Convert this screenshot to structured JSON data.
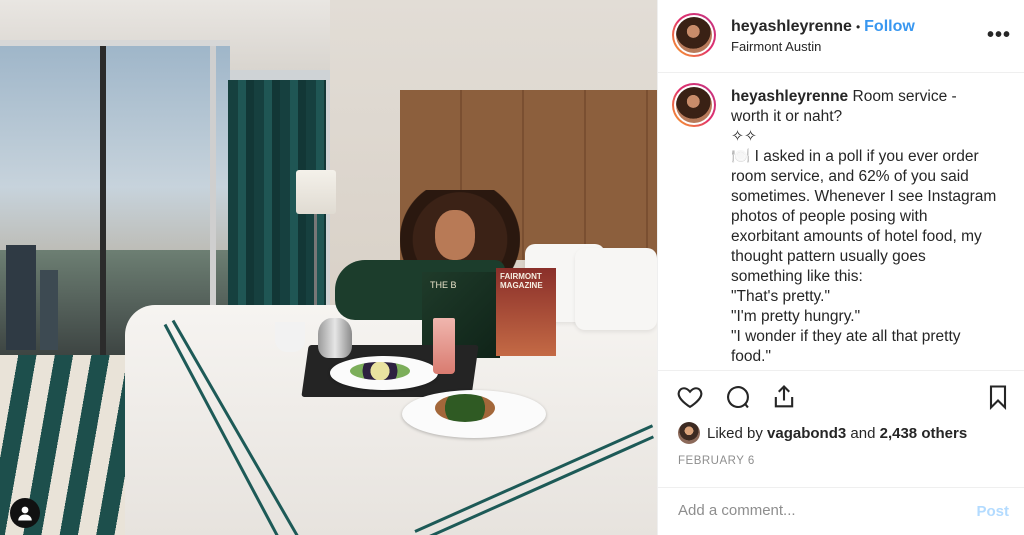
{
  "post": {
    "author": "heyashleyrenne",
    "follow_label": "Follow",
    "separator": "•",
    "location": "Fairmont Austin",
    "more_label": "•••"
  },
  "caption": {
    "author": "heyashleyrenne",
    "lines": [
      "Room service -",
      "worth it or naht?",
      "✧✧",
      "🍽️ I asked in a poll if you ever order",
      "room service, and 62% of you said",
      "sometimes. Whenever I see Instagram",
      "photos of people posing with",
      "exorbitant amounts of hotel food, my",
      "thought pattern usually goes",
      "something like this:",
      "\"That's pretty.\"",
      "\"I'm pretty hungry.\"",
      "\"I wonder if they ate all that pretty",
      "food.\""
    ]
  },
  "likes": {
    "prefix": "Liked by",
    "user": "vagabond3",
    "and": "and",
    "others": "2,438 others"
  },
  "date": "FEBRUARY 6",
  "comment": {
    "placeholder": "Add a comment...",
    "post_label": "Post"
  },
  "photo": {
    "magazine_left": "THE B",
    "magazine_right": "FAIRMONT MAGAZINE"
  },
  "icons": [
    "heart-icon",
    "comment-icon",
    "share-icon",
    "bookmark-icon",
    "user-profile-icon"
  ],
  "colors": {
    "link": "#3897f0",
    "post_disabled": "#b3dbff",
    "muted": "#8e8e8e",
    "text": "#262626"
  }
}
